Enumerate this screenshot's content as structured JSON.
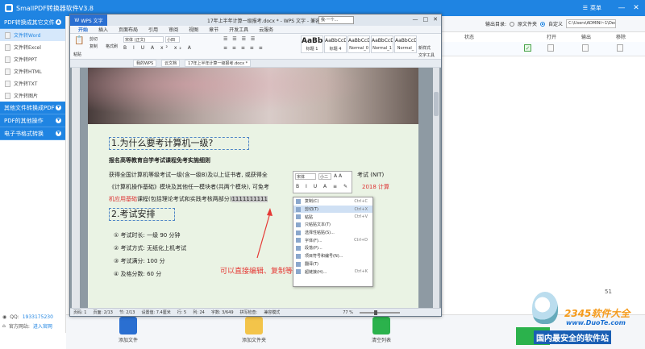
{
  "app": {
    "title": "SmallPDF转换器软件V3.8",
    "menu_label": "菜单",
    "win_minimize": "—",
    "win_close": "✕"
  },
  "sidebar": {
    "categories": [
      {
        "label": "PDF转换成其它文件",
        "items": [
          "文件转Word",
          "文件转Excel",
          "文件转PPT",
          "文件转HTML",
          "文件转TXT",
          "文件转图片"
        ]
      },
      {
        "label": "其他文件转换成PDF",
        "items": []
      },
      {
        "label": "PDF的其他操作",
        "items": []
      },
      {
        "label": "电子书格式转换",
        "items": []
      }
    ],
    "footer": {
      "qq_label": "QQ:",
      "qq_value": "1933175230",
      "site_label": "官方网站:",
      "site_value": "进入官网"
    }
  },
  "output": {
    "label": "输出目录:",
    "option_original": "原文件夹",
    "option_custom": "自定义",
    "path": "C:\\Users\\ADMINI~1\\Deskto"
  },
  "list": {
    "columns": {
      "status": "状态",
      "open": "打开",
      "output": "输出",
      "remove": "移除"
    }
  },
  "bottom": {
    "add_file": "添加文件",
    "add_folder": "添加文件夹",
    "clear_list": "清空列表"
  },
  "wps": {
    "brand": "WPS 文字",
    "doc_name": "17年上半年计算一级报考.docx * - WPS 文字 - 兼容模式",
    "mini_search": "我·一个...",
    "menus": [
      "开始",
      "插入",
      "页面布局",
      "引用",
      "审阅",
      "视图",
      "章节",
      "开发工具",
      "云服务"
    ],
    "ribbon": {
      "paste": "粘贴",
      "cut": "剪切",
      "copy": "复制",
      "format_painter": "格式刷",
      "font": "宋体 (正文)",
      "size": "小四",
      "styles": [
        {
          "preview": "AaBbC",
          "name": "标题 1"
        },
        {
          "preview": "AaBbCcDc",
          "name": "标题 4"
        },
        {
          "preview": "AaBbCcDc",
          "name": "Normal_0"
        },
        {
          "preview": "AaBbCcDc",
          "name": "Normal_1"
        },
        {
          "preview": "AaBbCcDc",
          "name": "Normal_"
        }
      ],
      "new_style": "新样式",
      "text_tools": "文字工具"
    },
    "tabs": [
      "我的WPS",
      "云文档",
      "17年上半年计算一级报考.docx *"
    ],
    "doc": {
      "h1": "1.为什么要考计算机一级?",
      "sub1": "报名高等教育自学考试课程免考实施细则",
      "p1a": "获得全国计算机等级考试一级(含一级B)及以上证书者, 或获得全",
      "p1b": "考试 (NIT)",
      "p2a": "《计算机操作基础》模块及其他任一模块者(共两个模块), 可免考",
      "p2b": "2018 计算",
      "p3a": "机应用基础",
      "p3b": "课程(包括理论考试和实践考核两部分)",
      "p3c": "1111111111",
      "h2": "2.考试安排",
      "list": [
        {
          "num": "①",
          "text": "考试时长: 一级 90 分钟"
        },
        {
          "num": "②",
          "text": "考试方式: 无纸化上机考试"
        },
        {
          "num": "③",
          "text": "考试满分: 100 分"
        },
        {
          "num": "④",
          "text": "及格分数: 60 分"
        }
      ],
      "note": "可以直接编辑、复制等。"
    },
    "float_toolbar": {
      "font": "宋体",
      "size": "小二"
    },
    "context_menu": [
      {
        "label": "复制(C)",
        "key": "Ctrl+C"
      },
      {
        "label": "剪切(T)",
        "key": "Ctrl+X"
      },
      {
        "label": "粘贴",
        "key": "Ctrl+V"
      },
      {
        "label": "只粘贴文本(T)",
        "key": ""
      },
      {
        "label": "选择性粘贴(S)...",
        "key": ""
      },
      {
        "label": "字体(F)...",
        "key": "Ctrl+D"
      },
      {
        "label": "段落(P)...",
        "key": ""
      },
      {
        "label": "项目符号和编号(N)...",
        "key": ""
      },
      {
        "label": "翻译(T)",
        "key": ""
      },
      {
        "label": "超链接(H)...",
        "key": "Ctrl+K"
      }
    ],
    "status": {
      "page": "页码: 1",
      "pages": "页面: 2/13",
      "section": "节: 2/13",
      "pos": "设置值: 7.4厘米",
      "row": "行: 5",
      "col": "列: 24",
      "chars": "字数: 3/649",
      "spell": "拼写检查:",
      "mode": "兼容模式",
      "zoom": "77 %"
    }
  },
  "watermark": {
    "title": "2345软件大全",
    "url": "www.DuoTe.com",
    "slogan": "国内最安全的软件站",
    "badge": "51"
  }
}
